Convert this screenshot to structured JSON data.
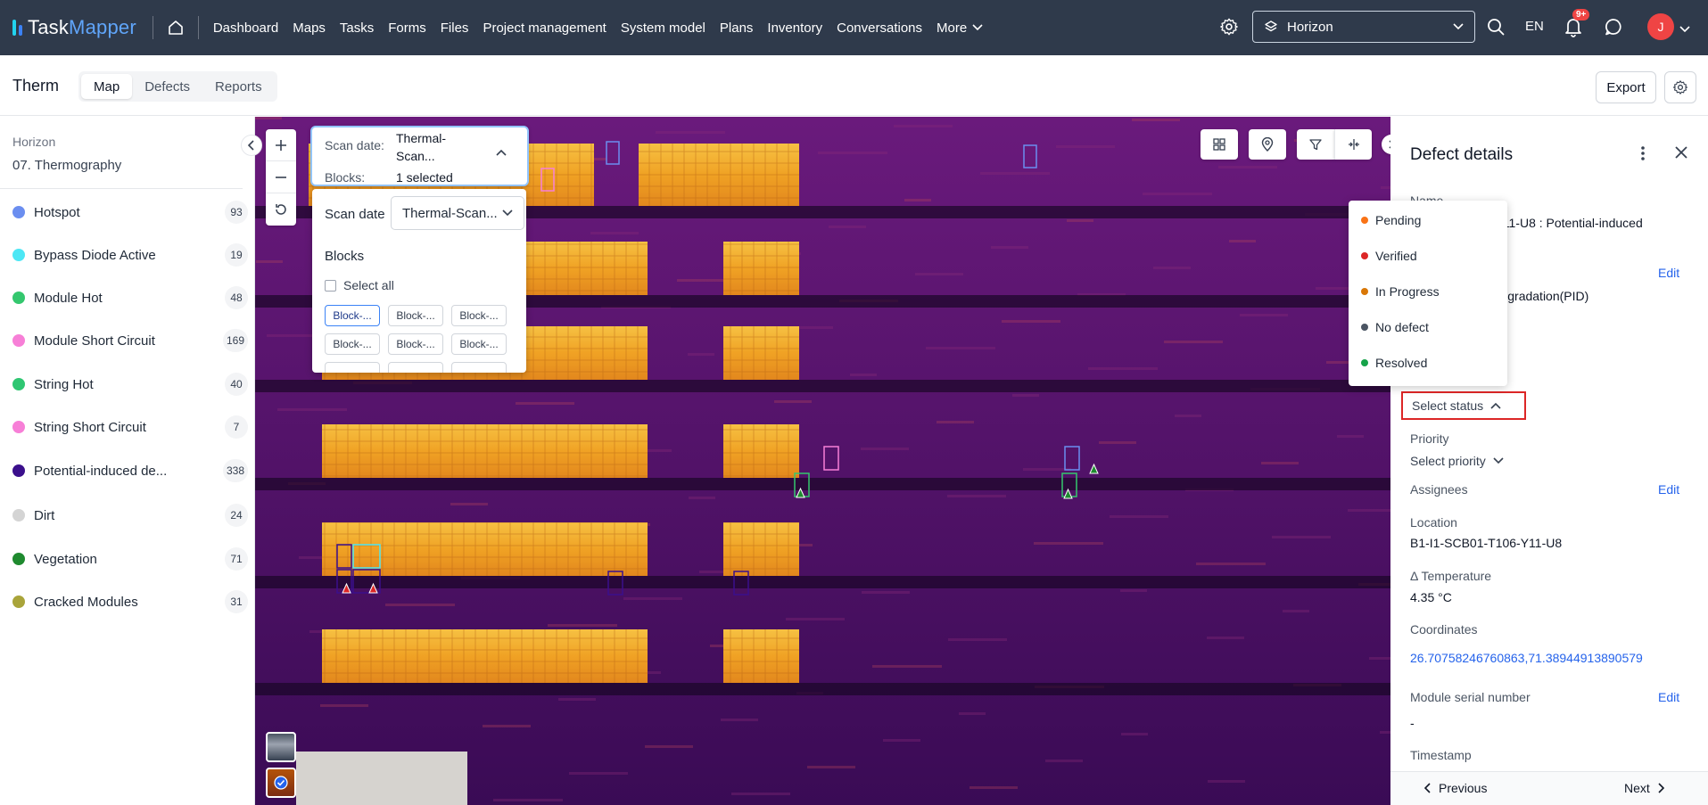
{
  "app": {
    "logo_part1": "Task",
    "logo_part2": "Mapper",
    "nav": [
      "Dashboard",
      "Maps",
      "Tasks",
      "Forms",
      "Files",
      "Project management",
      "System model",
      "Plans",
      "Inventory",
      "Conversations"
    ],
    "more_label": "More",
    "workspace": "Horizon",
    "language": "EN",
    "notifications_badge": "9+",
    "avatar_initial": "J"
  },
  "subheader": {
    "title": "Therm",
    "tabs": [
      "Map",
      "Defects",
      "Reports"
    ],
    "active_tab": "Map",
    "export_label": "Export"
  },
  "sidebar": {
    "org": "Horizon",
    "layer": "07. Thermography",
    "items": [
      {
        "label": "Hotspot",
        "count": "93",
        "color": "#6b8ef0"
      },
      {
        "label": "Bypass Diode Active",
        "count": "19",
        "color": "#4de7f5"
      },
      {
        "label": "Module Hot",
        "count": "48",
        "color": "#34c76e"
      },
      {
        "label": "Module Short Circuit",
        "count": "169",
        "color": "#f77fd7"
      },
      {
        "label": "String Hot",
        "count": "40",
        "color": "#2fc672"
      },
      {
        "label": "String Short Circuit",
        "count": "7",
        "color": "#f77fd7"
      },
      {
        "label": "Potential-induced de...",
        "count": "338",
        "color": "#3b0f8c"
      },
      {
        "label": "Dirt",
        "count": "24",
        "color": "#d4d4d4"
      },
      {
        "label": "Vegetation",
        "count": "71",
        "color": "#1f8a2f"
      },
      {
        "label": "Cracked Modules",
        "count": "31",
        "color": "#a9a43a"
      }
    ]
  },
  "scan": {
    "date_label": "Scan date:",
    "date_value": "Thermal-Scan...",
    "blocks_label": "Blocks:",
    "blocks_value": "1 selected",
    "panel_date_label": "Scan date",
    "panel_date_value": "Thermal-Scan...",
    "blocks_title": "Blocks",
    "select_all": "Select all",
    "chips": [
      "Block-...",
      "Block-...",
      "Block-...",
      "Block-...",
      "Block-...",
      "Block-..."
    ]
  },
  "details": {
    "title": "Defect details",
    "name_label": "Name",
    "name_value_line1": "6-Y11-U8 : Potential-induced",
    "name_value_line2": ")",
    "type_value": "d degradation(PID)",
    "edit_label": "Edit",
    "status_placeholder": "Select status",
    "priority_label": "Priority",
    "priority_placeholder": "Select priority",
    "assignees_label": "Assignees",
    "location_label": "Location",
    "location_value": "B1-I1-SCB01-T106-Y11-U8",
    "temp_label": "Δ Temperature",
    "temp_value": "4.35 °C",
    "coords_label": "Coordinates",
    "coords_value": "26.70758246760863,71.38944913890579",
    "serial_label": "Module serial number",
    "serial_value": "-",
    "timestamp_label": "Timestamp",
    "prev_label": "Previous",
    "next_label": "Next"
  },
  "status_menu": [
    {
      "label": "Pending",
      "color": "#f97316"
    },
    {
      "label": "Verified",
      "color": "#dc2626"
    },
    {
      "label": "In Progress",
      "color": "#d97706"
    },
    {
      "label": "No defect",
      "color": "#4b5563"
    },
    {
      "label": "Resolved",
      "color": "#16a34a"
    }
  ]
}
